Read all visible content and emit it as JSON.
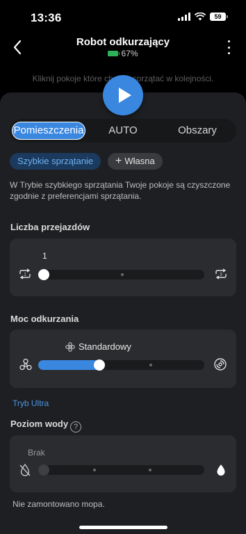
{
  "status_bar": {
    "time": "13:36",
    "battery_level": "59"
  },
  "header": {
    "title": "Robot odkurzający",
    "battery_percent": "67%"
  },
  "hint_text": "Kliknij pokoje które chcesz sprzątać w kolejności.",
  "mode_tabs": [
    {
      "label": "Pomieszczenia",
      "active": true
    },
    {
      "label": "AUTO",
      "active": false
    },
    {
      "label": "Obszary",
      "active": false
    }
  ],
  "chips": {
    "quick": "Szybkie sprzątanie",
    "custom": "Własna"
  },
  "description": "W Trybie szybkiego sprzątania Twoje pokoje są czyszczone zgodnie z preferencjami sprzątania.",
  "passes": {
    "title": "Liczba przejazdów",
    "value": "1",
    "min_label": "1",
    "max_label": "3",
    "level": 1
  },
  "suction": {
    "title": "Moc odkurzania",
    "value_label": "Standardowy",
    "level_fraction": 0.35
  },
  "ultra_link": "Tryb Ultra",
  "water": {
    "title": "Poziom wody",
    "help": "?",
    "value_label": "Brak",
    "level": 0
  },
  "mop_note": "Nie zamontowano mopa.",
  "colors": {
    "accent": "#3a87e0",
    "sheet": "#1e1f22",
    "card": "#2b2c2f"
  }
}
